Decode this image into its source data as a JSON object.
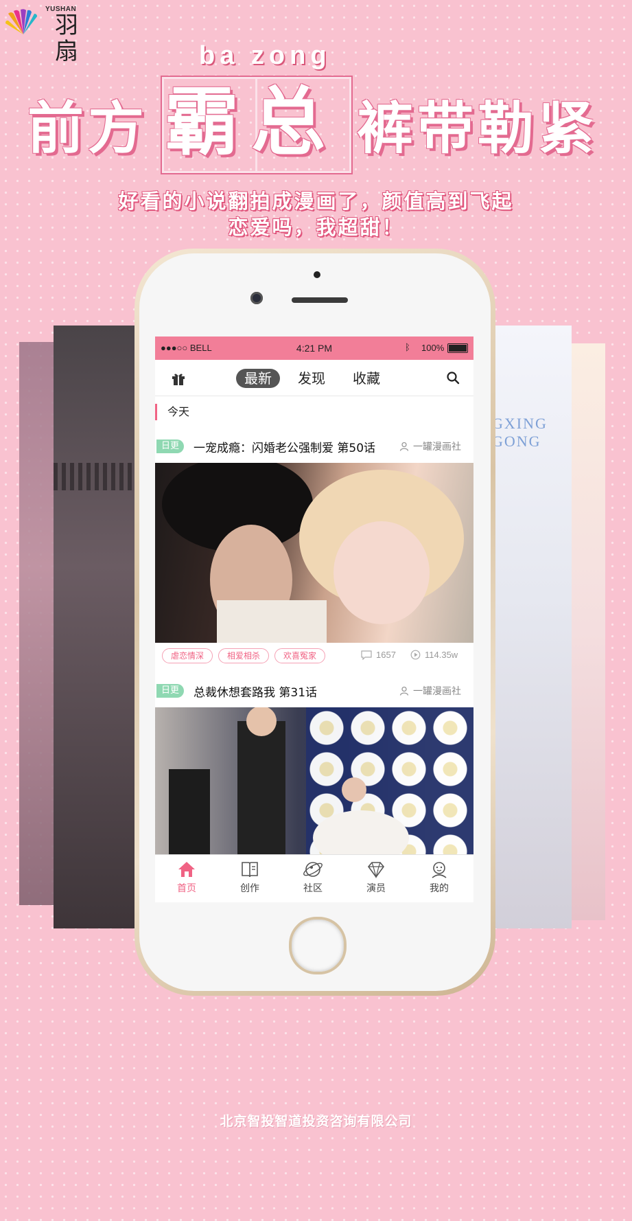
{
  "brand": {
    "small": "YUSHAN",
    "name": "羽扇"
  },
  "hero": {
    "pinyin": "ba zong",
    "left": "前方",
    "middle": "霸总",
    "right": "裤带勒紧",
    "tagline_1": "好看的小说翻拍成漫画了，颜值高到飞起",
    "tagline_2": "恋爱吗，我超甜！"
  },
  "side_cards": {
    "right_deco": "GXING GONG"
  },
  "statusbar": {
    "carrier": "●●●○○ BELL",
    "time": "4:21 PM",
    "battery": "100%"
  },
  "nav": {
    "tabs": [
      "最新",
      "发现",
      "收藏"
    ],
    "active": 0
  },
  "section": {
    "today": "今天"
  },
  "items": [
    {
      "badge": "日更",
      "title": "一宠成瘾：闪婚老公强制爱  第50话",
      "author": "一罐漫画社",
      "tags": [
        "虐恋情深",
        "相爱相杀",
        "欢喜冤家"
      ],
      "comments": "1657",
      "views": "114.35w"
    },
    {
      "badge": "日更",
      "title": "总裁休想套路我  第31话",
      "author": "一罐漫画社"
    }
  ],
  "tabbar": {
    "items": [
      {
        "label": "首页",
        "icon": "home-icon"
      },
      {
        "label": "创作",
        "icon": "book-icon"
      },
      {
        "label": "社区",
        "icon": "planet-icon"
      },
      {
        "label": "演员",
        "icon": "diamond-icon"
      },
      {
        "label": "我的",
        "icon": "face-icon"
      }
    ],
    "active": 0
  },
  "footer": {
    "company": "北京智投智道投资咨询有限公司"
  },
  "colors": {
    "accent": "#f06384",
    "status_bar": "#f27e98",
    "badge_green": "#8fd8b2",
    "background": "#f9c2d0"
  }
}
